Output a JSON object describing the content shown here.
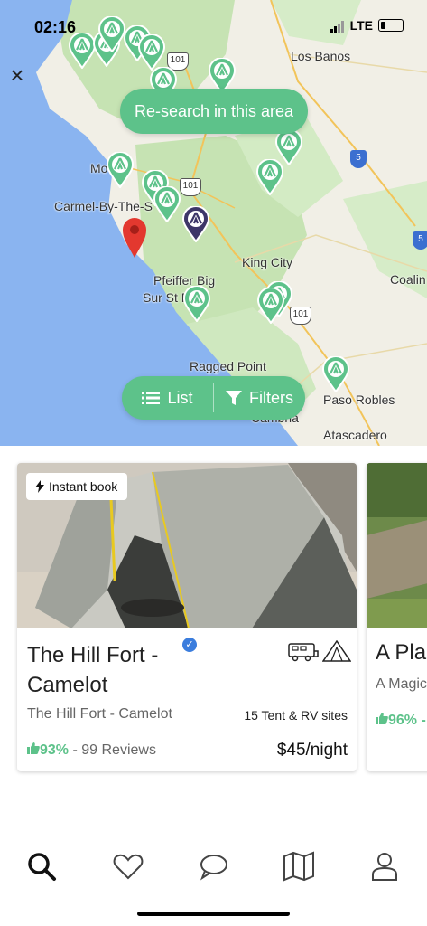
{
  "status_bar": {
    "time": "02:16",
    "network": "LTE"
  },
  "map": {
    "research_label": "Re-search in this area",
    "list_label": "List",
    "filters_label": "Filters",
    "labels": {
      "los_banos": "Los Banos",
      "monterey": "Mo      ey",
      "carmel": "Carmel-By-The-S",
      "king_city": "King City",
      "coalinga": "Coalin",
      "pfeiffer": "Pfeiffer Big",
      "sur": "Sur St    Park",
      "ragged_point": "Ragged Point",
      "paso_robles": "Paso Robles",
      "cambria": "Cambria",
      "atascadero": "Atascadero"
    },
    "highway_101": "101",
    "highway_5": "5",
    "colors": {
      "water": "#8ab4f0",
      "land": "#f1efe6",
      "park": "#c6e3b3",
      "accent": "#5dc28a",
      "selected_pin": "#3d3668",
      "red_pin": "#e3382f"
    }
  },
  "listing": {
    "badge": "Instant book",
    "title": "The Hill Fort - Camelot",
    "subtitle": "The Hill Fort - Camelot",
    "sites": "15 Tent & RV sites",
    "rating_pct": "93%",
    "reviews": "- 99 Reviews",
    "price": "$45/night",
    "type_icons": [
      "rv-icon",
      "tent-icon"
    ]
  },
  "next_listing": {
    "title": "A Pla",
    "subtitle": "A Magic",
    "rating_pct": "96% -"
  },
  "nav": [
    "search-icon",
    "heart-icon",
    "chat-icon",
    "map-icon",
    "profile-icon"
  ]
}
